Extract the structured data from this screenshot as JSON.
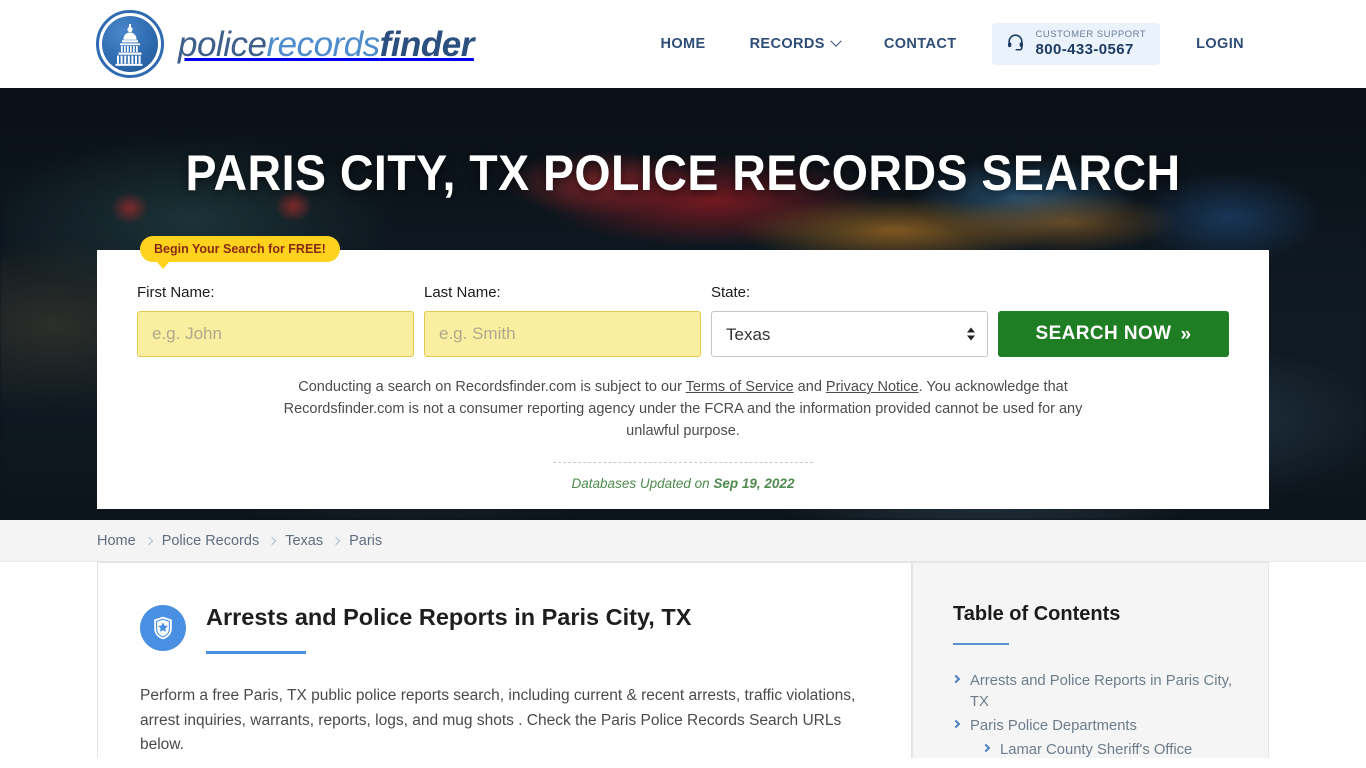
{
  "header": {
    "brand": {
      "part1": "police",
      "part2": "records",
      "part3": "finder",
      "icon": "capitol-dome-icon"
    },
    "nav": [
      {
        "label": "HOME",
        "has_caret": false
      },
      {
        "label": "RECORDS",
        "has_caret": true
      },
      {
        "label": "CONTACT",
        "has_caret": false
      }
    ],
    "support": {
      "icon": "headset-icon",
      "label": "CUSTOMER SUPPORT",
      "phone": "800-433-0567",
      "bg": "#eaf2fb"
    },
    "login_label": "LOGIN"
  },
  "hero": {
    "title": "PARIS CITY, TX POLICE RECORDS SEARCH"
  },
  "search": {
    "badge": "Begin Your Search for FREE!",
    "first_name": {
      "label": "First Name:",
      "value": "",
      "placeholder": "e.g. John"
    },
    "last_name": {
      "label": "Last Name:",
      "value": "",
      "placeholder": "e.g. Smith"
    },
    "state": {
      "label": "State:",
      "selected": "Texas",
      "options": [
        "Texas"
      ]
    },
    "button": "SEARCH NOW",
    "button_arrows": "»",
    "button_color": "#1f7d23",
    "disclaimer": {
      "part1": "Conducting a search on Recordsfinder.com is subject to our ",
      "link1": "Terms of Service",
      "part2": " and ",
      "link2": "Privacy Notice",
      "part3": ". You acknowledge that Recordsfinder.com is not a consumer reporting agency under the FCRA and the information provided cannot be used for any unlawful purpose."
    },
    "updated_prefix": "Databases Updated on ",
    "updated_date": "Sep 19, 2022"
  },
  "breadcrumb": [
    {
      "label": "Home"
    },
    {
      "label": "Police Records"
    },
    {
      "label": "Texas"
    },
    {
      "label": "Paris"
    }
  ],
  "article": {
    "icon": "police-badge-icon",
    "title": "Arrests and Police Reports in Paris City, TX",
    "body": "Perform a free Paris, TX public police reports search, including current & recent arrests, traffic violations, arrest inquiries, warrants, reports, logs, and mug shots . Check the Paris Police Records Search URLs below."
  },
  "toc": {
    "title": "Table of Contents",
    "items": [
      {
        "label": "Arrests and Police Reports in Paris City, TX",
        "sub": false
      },
      {
        "label": "Paris Police Departments",
        "sub": false
      },
      {
        "label": "Lamar County Sheriff's Office",
        "sub": true
      }
    ]
  }
}
